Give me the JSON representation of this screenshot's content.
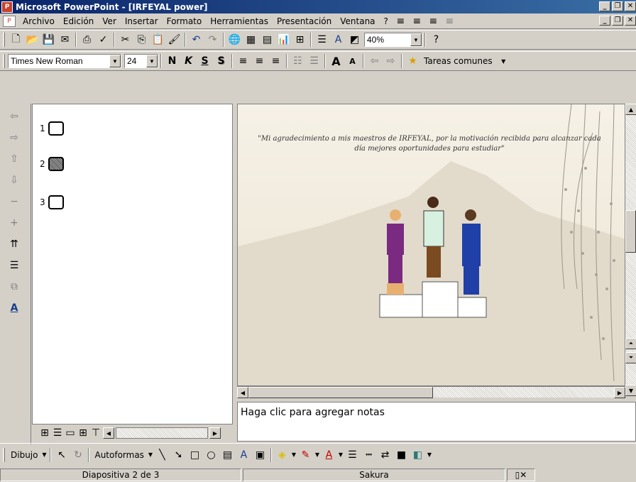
{
  "window": {
    "title": "Microsoft PowerPoint - [IRFEYAL power]"
  },
  "menu": {
    "items": [
      "Archivo",
      "Edición",
      "Ver",
      "Insertar",
      "Formato",
      "Herramientas",
      "Presentación",
      "Ventana",
      "?"
    ]
  },
  "toolbar_standard": {
    "zoom": "40%"
  },
  "toolbar_format": {
    "font_name": "Times New Roman",
    "font_size": "24",
    "bold": "N",
    "italic": "K",
    "underline": "S",
    "shadow": "S",
    "common_tasks": "Tareas comunes"
  },
  "outline": {
    "slides": [
      {
        "number": "1",
        "selected": false
      },
      {
        "number": "2",
        "selected": true
      },
      {
        "number": "3",
        "selected": false
      }
    ]
  },
  "slide": {
    "quote": "\"Mi agradecimiento a mis maestros de IRFEYAL, por la motivación recibida para alcanzar cada día mejores oportunidades para estudiar\""
  },
  "notes": {
    "placeholder": "Haga clic para agregar notas"
  },
  "drawing_toolbar": {
    "draw_label": "Dibujo",
    "autoshapes_label": "Autoformas"
  },
  "status": {
    "slide_info": "Diapositiva 2 de 3",
    "design": "Sakura"
  }
}
